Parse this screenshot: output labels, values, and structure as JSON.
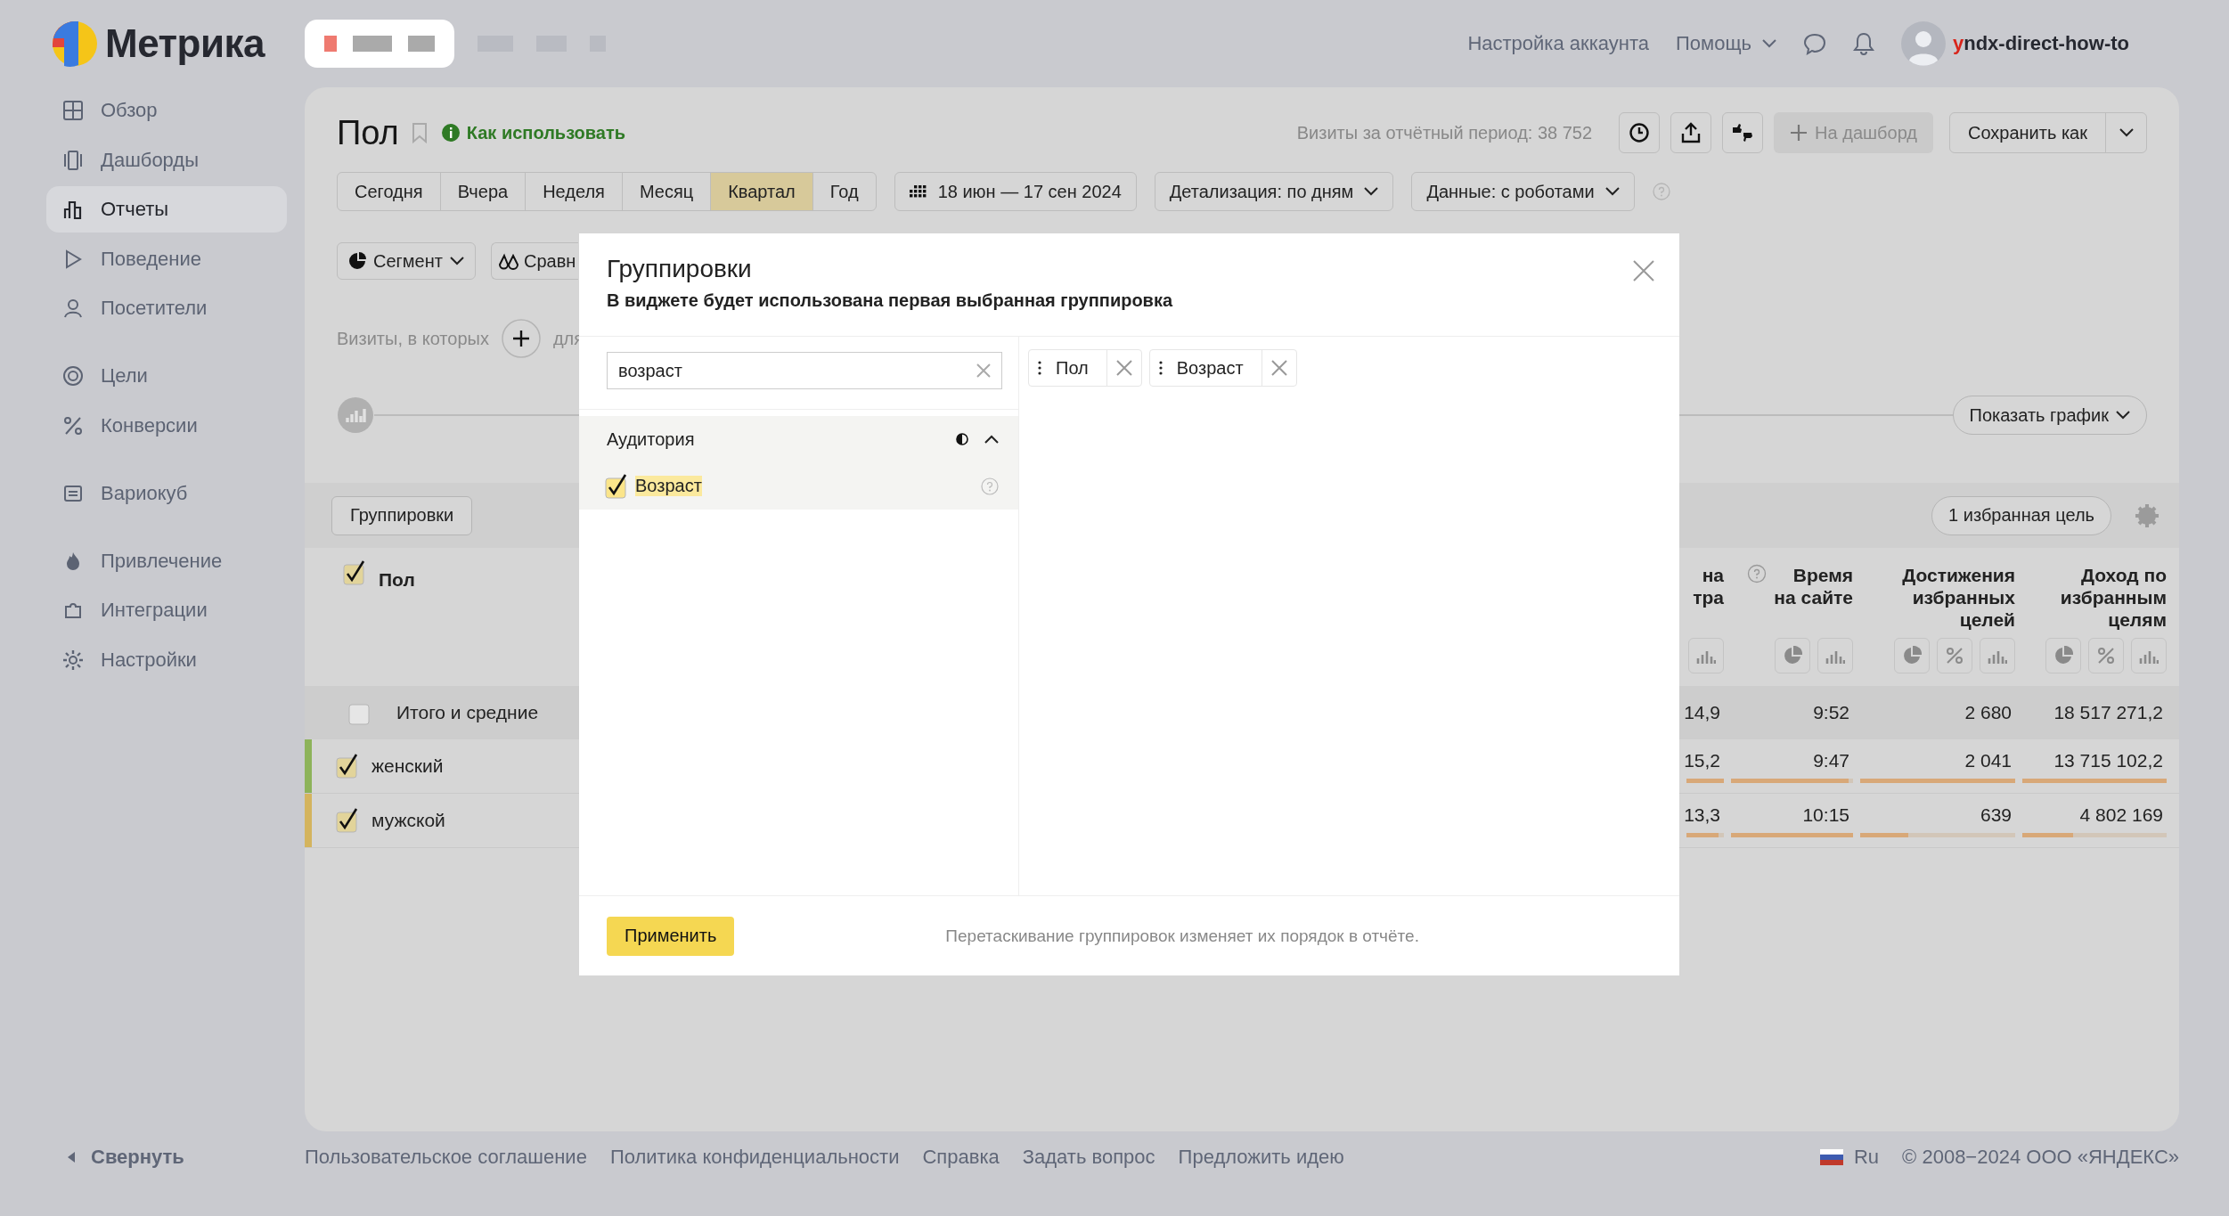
{
  "header": {
    "logo": "Метрика",
    "account_link": "Настройка аккаунта",
    "help_menu": "Помощь",
    "user": "yndx-direct-how-to"
  },
  "sidebar": {
    "groups": [
      [
        {
          "label": "Обзор",
          "selected": false
        },
        {
          "label": "Дашборды",
          "selected": false
        },
        {
          "label": "Отчеты",
          "selected": true
        },
        {
          "label": "Поведение",
          "selected": false
        },
        {
          "label": "Посетители",
          "selected": false
        }
      ],
      [
        {
          "label": "Цели",
          "selected": false
        },
        {
          "label": "Конверсии",
          "selected": false
        }
      ],
      [
        {
          "label": "Вариокуб",
          "selected": false
        }
      ],
      [
        {
          "label": "Привлечение",
          "selected": false
        },
        {
          "label": "Интеграции",
          "selected": false
        },
        {
          "label": "Настройки",
          "selected": false
        }
      ]
    ],
    "collapse": "Свернуть"
  },
  "report": {
    "title": "Пол",
    "help_link": "Как использовать",
    "visits": "Визиты за отчётный период: 38 752",
    "add_dashboard": {
      "label": "На дашборд",
      "disabled": true
    },
    "save": "Сохранить как",
    "periods": [
      {
        "label": "Сегодня",
        "selected": false
      },
      {
        "label": "Вчера",
        "selected": false
      },
      {
        "label": "Неделя",
        "selected": false
      },
      {
        "label": "Месяц",
        "selected": false
      },
      {
        "label": "Квартал",
        "selected": true
      },
      {
        "label": "Год",
        "selected": false
      }
    ],
    "date_range": "18 июн — 17 сен 2024",
    "detail": "Детализация: по дням",
    "data_filter": "Данные: с роботами",
    "segment": "Сегмент",
    "compare": "Сравн",
    "filter_label": "Визиты, в которых",
    "filter_more": "для",
    "show_chart": "Показать график",
    "groupings_button": "Группировки",
    "goals": "1 избранная цель"
  },
  "table": {
    "group_column": {
      "title": "Пол",
      "checked": true
    },
    "columns": [
      {
        "title": "на тра",
        "help": false,
        "tools": [
          {
            "kind": "bars"
          }
        ]
      },
      {
        "title": "Время на сайте",
        "help": true,
        "tools": [
          {
            "kind": "pie"
          },
          {
            "kind": "bars"
          }
        ]
      },
      {
        "title": "Достижения избранных целей",
        "help": false,
        "tools": [
          {
            "kind": "pie"
          },
          {
            "kind": "percent"
          },
          {
            "kind": "bars"
          }
        ]
      },
      {
        "title": "Доход по избранным целям",
        "help": false,
        "tools": [
          {
            "kind": "pie"
          },
          {
            "kind": "percent"
          },
          {
            "kind": "bars"
          }
        ]
      }
    ],
    "rows": [
      {
        "kind": "total",
        "label": "Итого и средние",
        "checked": false,
        "values": [
          {
            "text": "14,9"
          },
          {
            "text": "9:52"
          },
          {
            "text": "2 680"
          },
          {
            "text": "18 517 271,2"
          }
        ]
      },
      {
        "kind": "row",
        "label": "женский",
        "checked": true,
        "color": "#8db35a",
        "values": [
          {
            "text": "15,2",
            "level": 1
          },
          {
            "text": "9:47",
            "level": 0.96
          },
          {
            "text": "2 041",
            "level": 1
          },
          {
            "text": "13 715 102,2",
            "level": 1
          }
        ]
      },
      {
        "kind": "row",
        "label": "мужской",
        "checked": true,
        "color": "#d4b45e",
        "values": [
          {
            "text": "13,3",
            "level": 0.85
          },
          {
            "text": "10:15",
            "level": 1
          },
          {
            "text": "639",
            "level": 0.31
          },
          {
            "text": "4 802 169",
            "level": 0.35
          }
        ]
      }
    ]
  },
  "dialog": {
    "title": "Группировки",
    "subtitle": "В виджете будет использована первая выбранная группировка",
    "search": {
      "value": "возраст"
    },
    "sections": [
      {
        "title": "Аудитория",
        "expanded": true,
        "items": [
          {
            "label": "Возраст",
            "checked": true,
            "match": true
          }
        ]
      }
    ],
    "chips": [
      {
        "label": "Пол"
      },
      {
        "label": "Возраст"
      }
    ],
    "apply": "Применить",
    "hint": "Перетаскивание группировок изменяет их порядок в отчёте."
  },
  "footer": {
    "links": [
      "Пользовательское соглашение",
      "Политика конфиденциальности",
      "Справка",
      "Задать вопрос",
      "Предложить идею"
    ],
    "language": "Ru",
    "copyright": "© 2008−2024 ООО «ЯНДЕКС»"
  }
}
